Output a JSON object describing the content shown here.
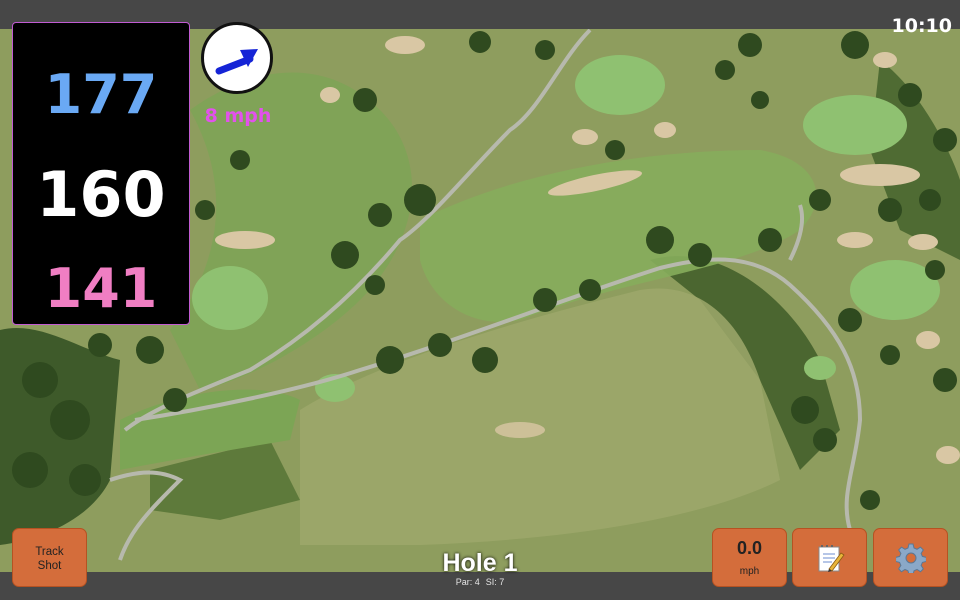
{
  "status": {
    "time": "10:10"
  },
  "yardages": {
    "back": "177",
    "middle": "160",
    "front": "141"
  },
  "colors": {
    "back": "#6aa9f4",
    "middle": "#ffffff",
    "front": "#f07ec3",
    "wind_arrow": "#1524d6",
    "wind_text": "#e251ec",
    "button": "#d46d3b",
    "panel_border": "#c15bd2"
  },
  "wind": {
    "speed_label": "8 mph",
    "icon": "wind-direction-arrow-icon"
  },
  "buttons": {
    "track_shot_line1": "Track",
    "track_shot_line2": "Shot",
    "speed_value": "0.0",
    "speed_unit": "mph",
    "notes_icon": "notepad-icon",
    "settings_icon": "gear-icon"
  },
  "hole": {
    "title": "Hole 1",
    "par": "Par: 4",
    "si": "SI: 7"
  },
  "map": {
    "icon": "satellite-map-image"
  }
}
